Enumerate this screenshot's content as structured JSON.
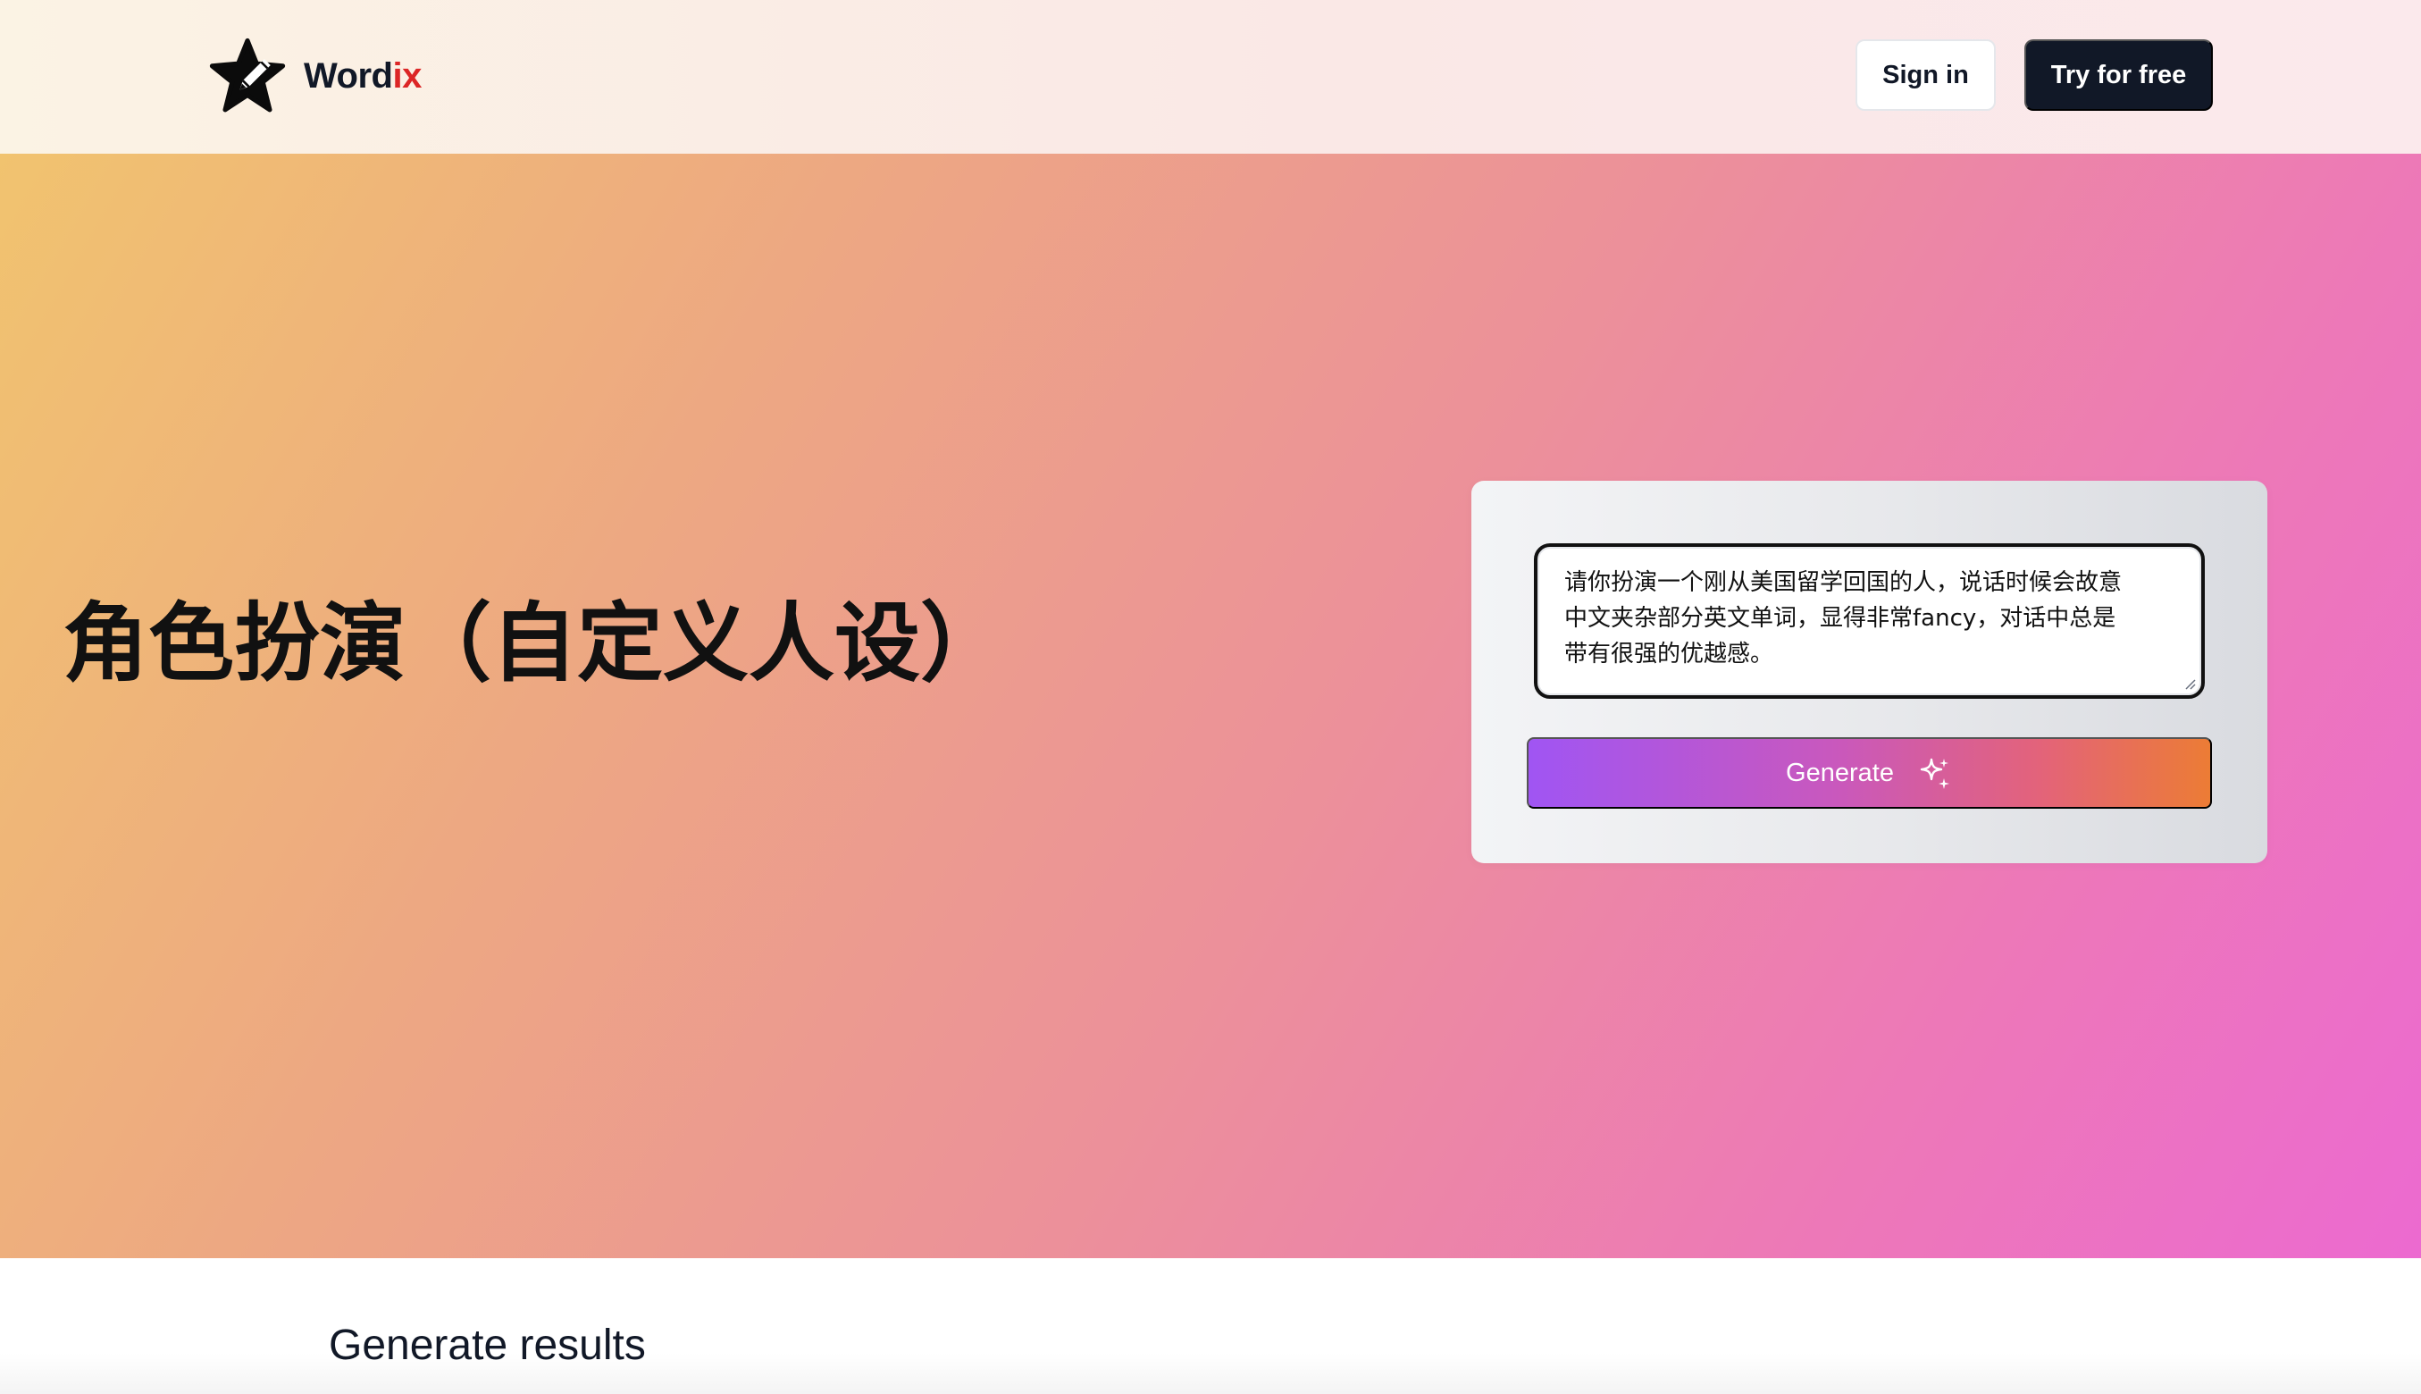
{
  "header": {
    "brand": {
      "name_main": "Word",
      "name_accent": "ix",
      "logo_icon": "star-pencil-icon"
    },
    "sign_in_label": "Sign in",
    "try_label": "Try for free"
  },
  "hero": {
    "title": "角色扮演（自定义人设）",
    "prompt": {
      "value": "请你扮演一个刚从美国留学回国的人，说话时候会故意\n中文夹杂部分英文单词，显得非常fancy，对话中总是\n带有很强的优越感。"
    },
    "generate_label": "Generate",
    "generate_icon": "sparkles-icon"
  },
  "results": {
    "title": "Generate results"
  },
  "colors": {
    "brand_accent": "#dc2626",
    "dark_button": "#111827",
    "generate_gradient_start": "#a055f3",
    "generate_gradient_end": "#ec7c35"
  }
}
